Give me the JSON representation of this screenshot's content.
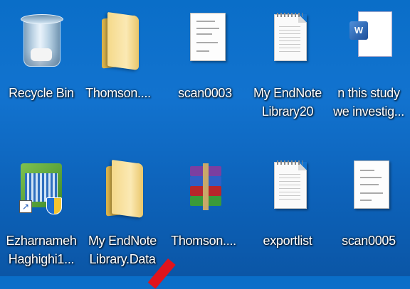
{
  "desktop": {
    "icons": [
      {
        "label": "Recycle Bin",
        "icon": "recycle-bin-icon"
      },
      {
        "label": "Thomson....",
        "icon": "folder-icon"
      },
      {
        "label": "scan0003",
        "icon": "scanned-document-icon"
      },
      {
        "label": "My EndNote\nLibrary20",
        "icon": "text-document-icon"
      },
      {
        "label": "n this study\nwe investig...",
        "icon": "word-document-icon"
      },
      {
        "label": "Ezharnameh\nHaghighi1...",
        "icon": "application-shortcut-icon"
      },
      {
        "label": "My EndNote\nLibrary.Data",
        "icon": "folder-icon"
      },
      {
        "label": "Thomson....",
        "icon": "winrar-archive-icon"
      },
      {
        "label": "exportlist",
        "icon": "text-document-icon"
      },
      {
        "label": "scan0005",
        "icon": "scanned-document-icon"
      }
    ]
  },
  "colors": {
    "desktop_background": "#1273cf",
    "label_text": "#ffffff",
    "cursor": "#e0141c"
  }
}
